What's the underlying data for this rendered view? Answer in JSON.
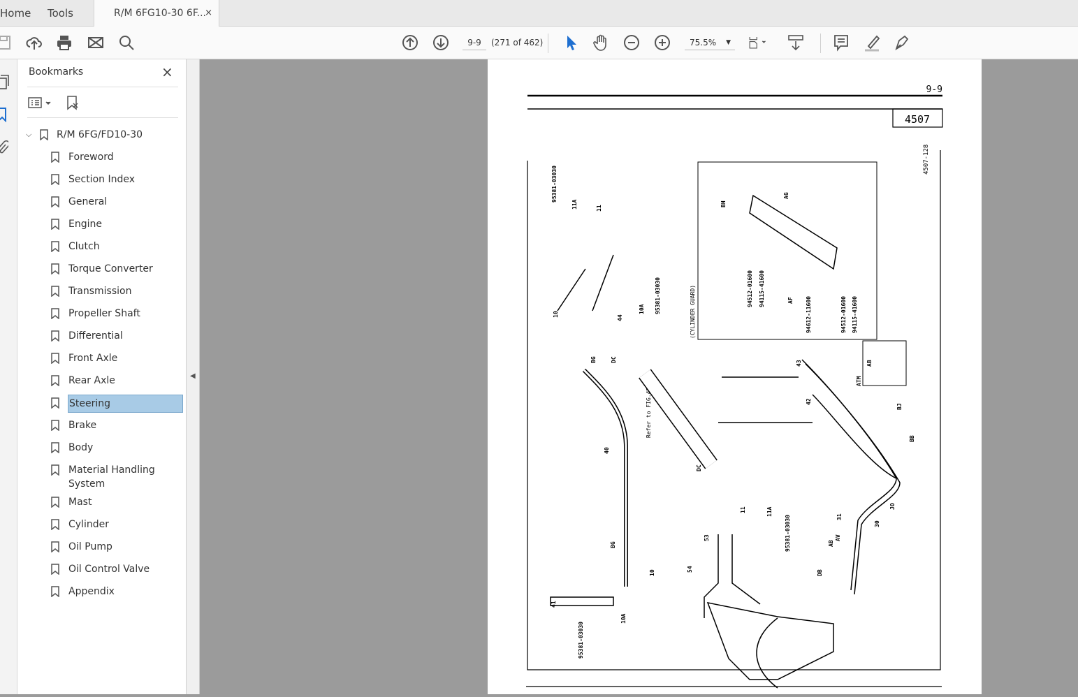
{
  "tabs": {
    "home": "Home",
    "tools": "Tools",
    "document": "R/M 6FG10-30 6F...",
    "close": "×"
  },
  "toolbar": {
    "page_value": "9-9",
    "page_count": "(271 of 462)",
    "zoom_value": "75.5%"
  },
  "bookmarks": {
    "title": "Bookmarks",
    "close": "×",
    "root": "R/M 6FG/FD10-30",
    "items": [
      "Foreword",
      "Section Index",
      "General",
      "Engine",
      "Clutch",
      "Torque Converter",
      "Transmission",
      "Propeller Shaft",
      "Differential",
      "Front Axle",
      "Rear Axle",
      "Steering",
      "Brake",
      "Body",
      "Material Handling System",
      "Mast",
      "Cylinder",
      "Oil Pump",
      "Oil Control Valve",
      "Appendix"
    ],
    "selected": "Steering"
  },
  "page": {
    "page_number": "9-9",
    "figure_number": "4507",
    "figure_code": "4507-128",
    "cylinder_guard": "(CYLINDER GUARD)",
    "refer": "Refer to FIG.4508",
    "labels": [
      "95381-03030",
      "11A",
      "11",
      "10",
      "44",
      "10A",
      "95381-03030",
      "BG",
      "DC",
      "40",
      "BG",
      "10",
      "41",
      "10A",
      "95381-03030",
      "DC",
      "11",
      "11A",
      "95381-03030",
      "BH",
      "AG",
      "94512-01600",
      "94115-41600",
      "AF",
      "94612-11600",
      "94512-01600",
      "94115-41600",
      "AB",
      "ATM",
      "43",
      "42",
      "BJ",
      "BB",
      "JO",
      "31",
      "30",
      "AV",
      "AB",
      "DB",
      "53",
      "54"
    ]
  }
}
